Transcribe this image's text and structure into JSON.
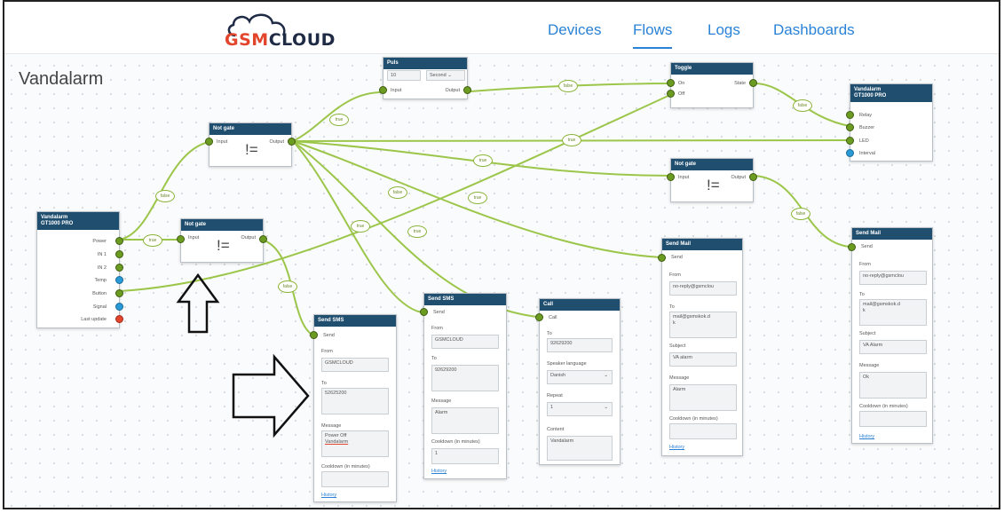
{
  "app": {
    "logo_prefix": "GSM",
    "logo_suffix": "CLOUD"
  },
  "nav": {
    "devices": "Devices",
    "flows": "Flows",
    "logs": "Logs",
    "dashboards": "Dashboards",
    "active": "Flows"
  },
  "page_title": "Vandalarm",
  "colors": {
    "node_header": "#1f4e6e",
    "wire": "#8bbf3a",
    "port_green": "#6c9b22",
    "port_blue": "#2a9ad6",
    "port_red": "#e2452c",
    "nav": "#2a82d6"
  },
  "nodes": {
    "device_left": {
      "title": "Vandalarm",
      "subtitle": "GT1000 PRO",
      "ports": [
        "Power",
        "IN 1",
        "IN 2",
        "Temp",
        "Button",
        "Signal",
        "Last update"
      ]
    },
    "not_gate_1": {
      "title": "Not gate",
      "input": "Input",
      "output": "Output",
      "symbol": "!="
    },
    "not_gate_2": {
      "title": "Not gate",
      "input": "Input",
      "output": "Output",
      "symbol": "!="
    },
    "not_gate_3": {
      "title": "Not gate",
      "input": "Input",
      "output": "Output",
      "symbol": "!="
    },
    "puls": {
      "title": "Puls",
      "value": "10",
      "unit": "Second",
      "input": "Input",
      "output": "Output"
    },
    "toggle": {
      "title": "Toggle",
      "on": "On",
      "off": "Off",
      "state": "State"
    },
    "device_right": {
      "title": "Vandalarm",
      "subtitle": "GT1000 PRO",
      "ports": [
        "Relay",
        "Buzzer",
        "LED",
        "Interval"
      ]
    },
    "send_sms_1": {
      "title": "Send SMS",
      "send": "Send",
      "from_label": "From",
      "from": "GSMCLOUD",
      "to_label": "To",
      "to": "52625200",
      "message_label": "Message",
      "message_line1": "Power Off",
      "message_line2": "Vandalarm",
      "cooldown_label": "Cooldown (in minutes)",
      "history": "History"
    },
    "send_sms_2": {
      "title": "Send SMS",
      "send": "Send",
      "from_label": "From",
      "from": "GSMCLOUD",
      "to_label": "To",
      "to": "92629200",
      "message_label": "Message",
      "message": "Alarm",
      "cooldown_label": "Cooldown (in minutes)",
      "cooldown": "1",
      "history": "History"
    },
    "call": {
      "title": "Call",
      "call": "Call",
      "to_label": "To",
      "to": "92629200",
      "speaker_label": "Speaker language",
      "speaker": "Danish",
      "repeat_label": "Repeat",
      "repeat": "1",
      "content_label": "Content",
      "content": "Vandalarm"
    },
    "send_mail_1": {
      "title": "Send Mail",
      "send": "Send",
      "from_label": "From",
      "from": "no-reply@gsmclou",
      "to_label": "To",
      "to_line1": "mail@gsmskok.d",
      "to_line2": "k",
      "subject_label": "Subject",
      "subject": "VA alarm",
      "message_label": "Message",
      "message": "Alarm",
      "cooldown_label": "Cooldown (in minutes)",
      "history": "History"
    },
    "send_mail_2": {
      "title": "Send Mail",
      "send": "Send",
      "from_label": "From",
      "from": "no-reply@gsmclou",
      "to_label": "To",
      "to_line1": "mail@gsmskok.d",
      "to_line2": "k",
      "subject_label": "Subject",
      "subject": "VA Alarm",
      "message_label": "Message",
      "message": "Ok",
      "cooldown_label": "Cooldown (in minutes)",
      "history": "History"
    }
  },
  "wire_labels": {
    "true": "true",
    "false": "false"
  }
}
